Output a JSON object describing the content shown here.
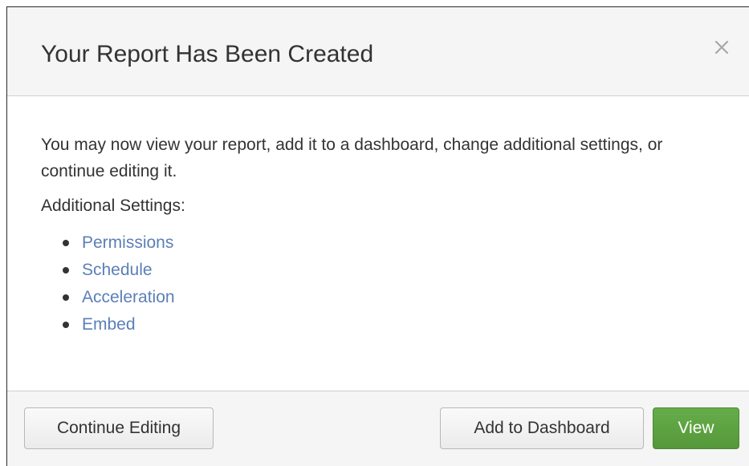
{
  "dialog": {
    "title": "Your Report Has Been Created",
    "close_icon": "close-icon",
    "intro": "You may now view your report, add it to a dashboard, change additional settings, or continue editing it.",
    "settings_heading": "Additional Settings:",
    "settings_links": [
      {
        "label": "Permissions"
      },
      {
        "label": "Schedule"
      },
      {
        "label": "Acceleration"
      },
      {
        "label": "Embed"
      }
    ]
  },
  "footer": {
    "continue_label": "Continue Editing",
    "add_label": "Add to Dashboard",
    "view_label": "View"
  },
  "colors": {
    "link": "#5b7fb7",
    "primary_button": "#5ba340",
    "header_bg": "#f5f5f5"
  }
}
